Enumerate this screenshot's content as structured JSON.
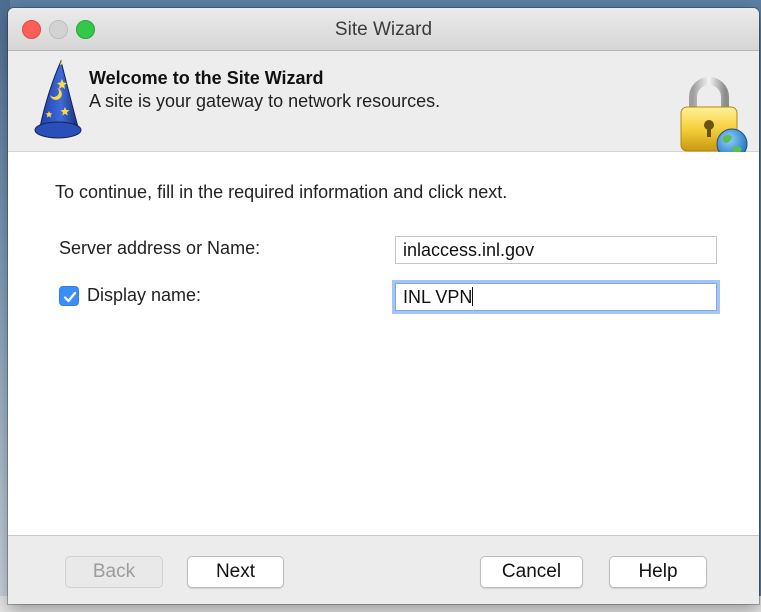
{
  "window": {
    "title": "Site Wizard"
  },
  "header": {
    "title": "Welcome to the Site Wizard",
    "subtitle": "A site is your gateway to network resources.",
    "left_icon": "wizard-hat-icon",
    "right_icon": "lock-globe-icon"
  },
  "form": {
    "instruction": "To continue, fill in the required information and click next.",
    "server_label": "Server address or Name:",
    "server_value": "inlaccess.inl.gov",
    "display_label": "Display name:",
    "display_checked": true,
    "display_value": "INL VPN"
  },
  "buttons": {
    "back": "Back",
    "next": "Next",
    "cancel": "Cancel",
    "help": "Help"
  },
  "colors": {
    "accent": "#3b8ef8",
    "close": "#fc5f57",
    "maximize": "#34c84a"
  }
}
